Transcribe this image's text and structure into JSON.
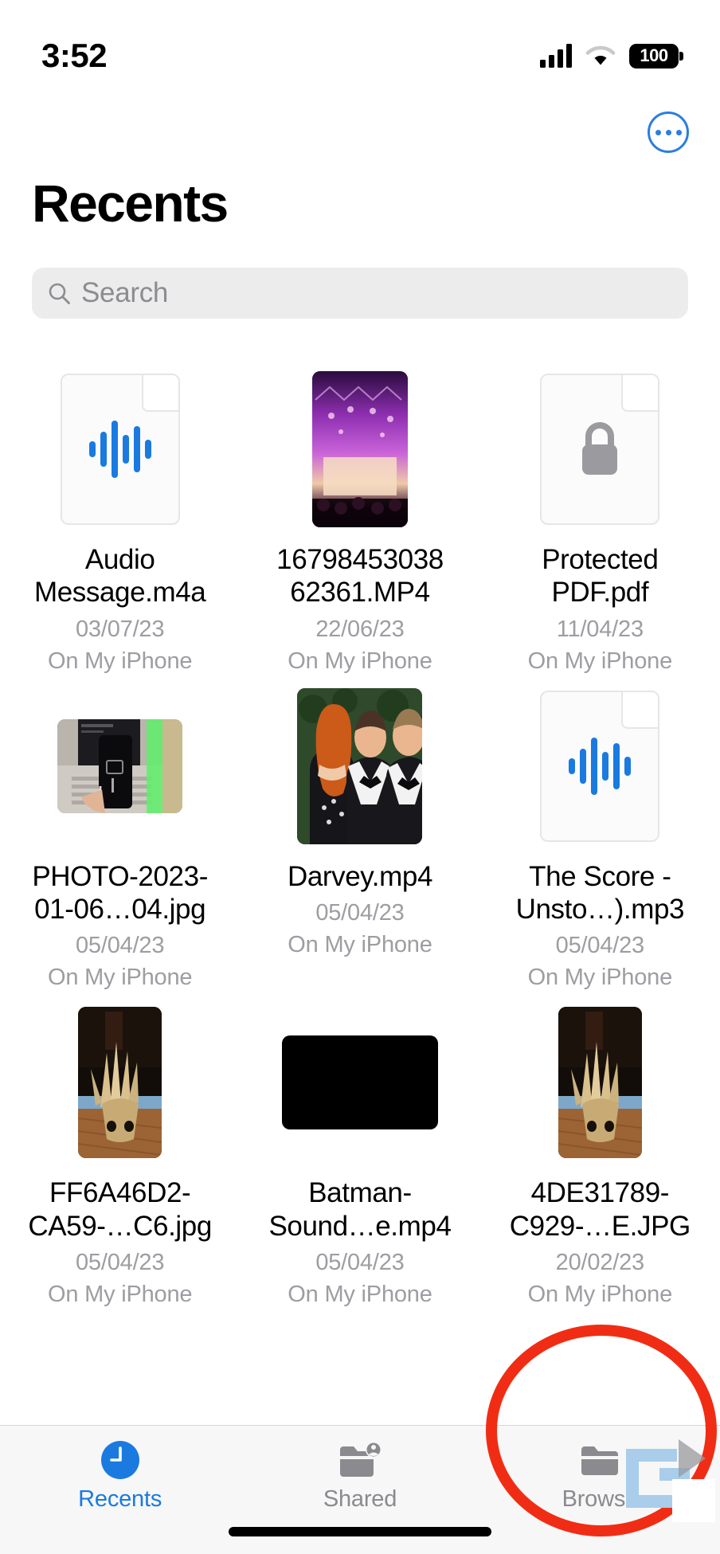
{
  "status_bar": {
    "time": "3:52",
    "battery_percent": "100",
    "cellular_icon": "cellular-signal-icon",
    "wifi_icon": "wifi-icon",
    "battery_icon": "battery-icon"
  },
  "nav": {
    "more_button_icon": "ellipsis-circle-icon",
    "more_button_label": "More"
  },
  "header": {
    "title": "Recents"
  },
  "search": {
    "placeholder": "Search",
    "value": "",
    "icon": "search-icon"
  },
  "files": [
    {
      "name": "Audio Message.m4a",
      "date": "03/07/23",
      "location": "On My iPhone",
      "thumb": "audio-waveform-document-icon"
    },
    {
      "name": "16798453038 62361.MP4",
      "date": "22/06/23",
      "location": "On My iPhone",
      "thumb": "concert-stage-video-thumbnail"
    },
    {
      "name": "Protected PDF.pdf",
      "date": "11/04/23",
      "location": "On My iPhone",
      "thumb": "lock-protected-document-icon"
    },
    {
      "name": "PHOTO-2023-01-06…04.jpg",
      "date": "05/04/23",
      "location": "On My iPhone",
      "thumb": "phone-on-laptop-photo-thumbnail"
    },
    {
      "name": "Darvey.mp4",
      "date": "05/04/23",
      "location": "On My iPhone",
      "thumb": "people-in-formalwear-video-thumbnail"
    },
    {
      "name": "The Score - Unsto…).mp3",
      "date": "05/04/23",
      "location": "On My iPhone",
      "thumb": "audio-waveform-document-icon"
    },
    {
      "name": "FF6A46D2-CA59-…C6.jpg",
      "date": "05/04/23",
      "location": "On My iPhone",
      "thumb": "potted-plant-photo-thumbnail"
    },
    {
      "name": "Batman-Sound…e.mp4",
      "date": "05/04/23",
      "location": "On My iPhone",
      "thumb": "black-video-thumbnail"
    },
    {
      "name": "4DE31789-C929-…E.JPG",
      "date": "20/02/23",
      "location": "On My iPhone",
      "thumb": "potted-plant-photo-thumbnail"
    }
  ],
  "tabbar": {
    "tabs": [
      {
        "label": "Recents",
        "icon": "clock-icon",
        "active": true
      },
      {
        "label": "Shared",
        "icon": "folder-person-icon",
        "active": false
      },
      {
        "label": "Browse",
        "icon": "folder-icon",
        "active": false
      }
    ]
  },
  "annotation": {
    "shape": "red-ellipse-highlight",
    "target": "Browse",
    "color": "#f02d14"
  },
  "colors": {
    "accent_blue": "#1a7ae0",
    "search_bg": "#ececed",
    "meta_gray": "#9d9da2",
    "tabbar_bg": "#f7f7f7"
  }
}
